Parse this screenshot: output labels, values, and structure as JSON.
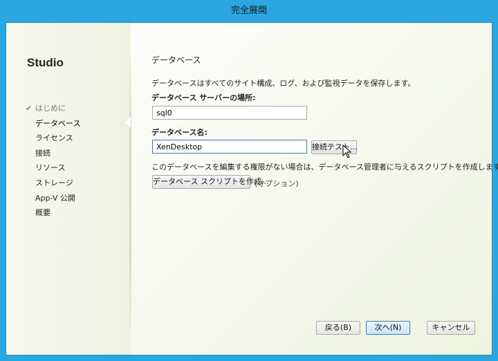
{
  "window": {
    "title": "完全展開"
  },
  "sidebar": {
    "brand": "Studio",
    "items": [
      {
        "label": "はじめに",
        "state": "done"
      },
      {
        "label": "データベース",
        "state": "current"
      },
      {
        "label": "ライセンス",
        "state": "pending"
      },
      {
        "label": "接続",
        "state": "pending"
      },
      {
        "label": "リソース",
        "state": "pending"
      },
      {
        "label": "ストレージ",
        "state": "pending"
      },
      {
        "label": "App-V 公開",
        "state": "pending"
      },
      {
        "label": "概要",
        "state": "pending"
      }
    ]
  },
  "main": {
    "heading": "データベース",
    "description": "データベースはすべてのサイト構成、ログ、および監視データを保存します。",
    "server_label": "データベース サーバーの場所:",
    "server_value": "sql0",
    "dbname_label": "データベース名:",
    "dbname_value": "XenDesktop",
    "test_button": "接続テスト...",
    "permission_note": "このデータベースを編集する権限がない場合は、データベース管理者に与えるスクリプトを作成します。",
    "script_button": "データベース スクリプトを作成...",
    "optional": "(オプション)"
  },
  "footer": {
    "back": "戻る(B)",
    "next": "次へ(N)",
    "cancel": "キャンセル"
  }
}
